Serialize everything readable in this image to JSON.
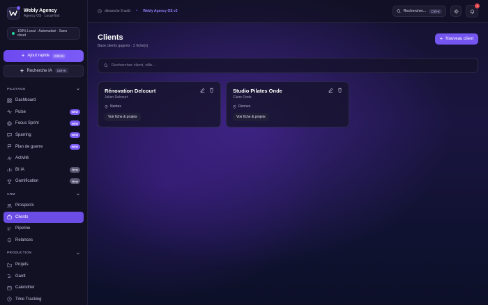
{
  "brand": {
    "name": "Webly Agency",
    "subtitle": "Agency OS · Local-first"
  },
  "local_status": "100% Local · Automatisé · Sans cloud",
  "quick_add": {
    "label": "Ajout rapide",
    "shortcut": "Ctrl+N"
  },
  "ia_search": {
    "label": "Recherche IA",
    "shortcut": "Ctrl+K"
  },
  "sections": {
    "pilotage": "PILOTAGE",
    "crm": "CRM",
    "production": "PRODUCTION"
  },
  "nav": {
    "pilotage": [
      {
        "label": "Dashboard",
        "icon": "grid-icon",
        "badge": ""
      },
      {
        "label": "Pulse",
        "icon": "pulse-icon",
        "badge": "NEW"
      },
      {
        "label": "Focus Sprint",
        "icon": "target-icon",
        "badge": "NEW"
      },
      {
        "label": "Sparring",
        "icon": "chat-icon",
        "badge": "NEW"
      },
      {
        "label": "Plan de guerre",
        "icon": "flag-icon",
        "badge": "NEW"
      },
      {
        "label": "Activité",
        "icon": "activity-icon",
        "badge": ""
      },
      {
        "label": "BI IA",
        "icon": "chart-icon",
        "badge": "Bêta"
      },
      {
        "label": "Gamification",
        "icon": "trophy-icon",
        "badge": "Bêta"
      }
    ],
    "crm": [
      {
        "label": "Prospects",
        "icon": "users-icon"
      },
      {
        "label": "Clients",
        "icon": "briefcase-icon"
      },
      {
        "label": "Pipeline",
        "icon": "pipeline-icon"
      },
      {
        "label": "Relances",
        "icon": "bell-icon"
      }
    ],
    "production": [
      {
        "label": "Projets",
        "icon": "folder-icon"
      },
      {
        "label": "Gantt",
        "icon": "gantt-icon"
      },
      {
        "label": "Calendrier",
        "icon": "calendar-icon"
      },
      {
        "label": "Time Tracking",
        "icon": "clock-icon"
      }
    ]
  },
  "topbar": {
    "date": "dimanche 9 août",
    "version": "Webly Agency OS v3",
    "search_label": "Rechercher...",
    "search_shortcut": "Ctrl+K",
    "notifications": "1"
  },
  "page": {
    "title": "Clients",
    "subtitle": "Base clients gagnés · 2 fiche(s)",
    "new_button": "Nouveau client",
    "search_placeholder": "Rechercher client, ville..."
  },
  "clients": [
    {
      "name": "Rénovation Delcourt",
      "contact": "Julien Delcourt",
      "city": "Nantes",
      "action": "Voir fiche & projets"
    },
    {
      "name": "Studio Pilates Onde",
      "contact": "Claire Onde",
      "city": "Rennes",
      "action": "Voir fiche & projets"
    }
  ],
  "colors": {
    "accent": "#7455f0",
    "background": "#0d0c1c",
    "new_badge": "#7c5cf7",
    "success": "#22d39a",
    "alert": "#e5484d"
  }
}
